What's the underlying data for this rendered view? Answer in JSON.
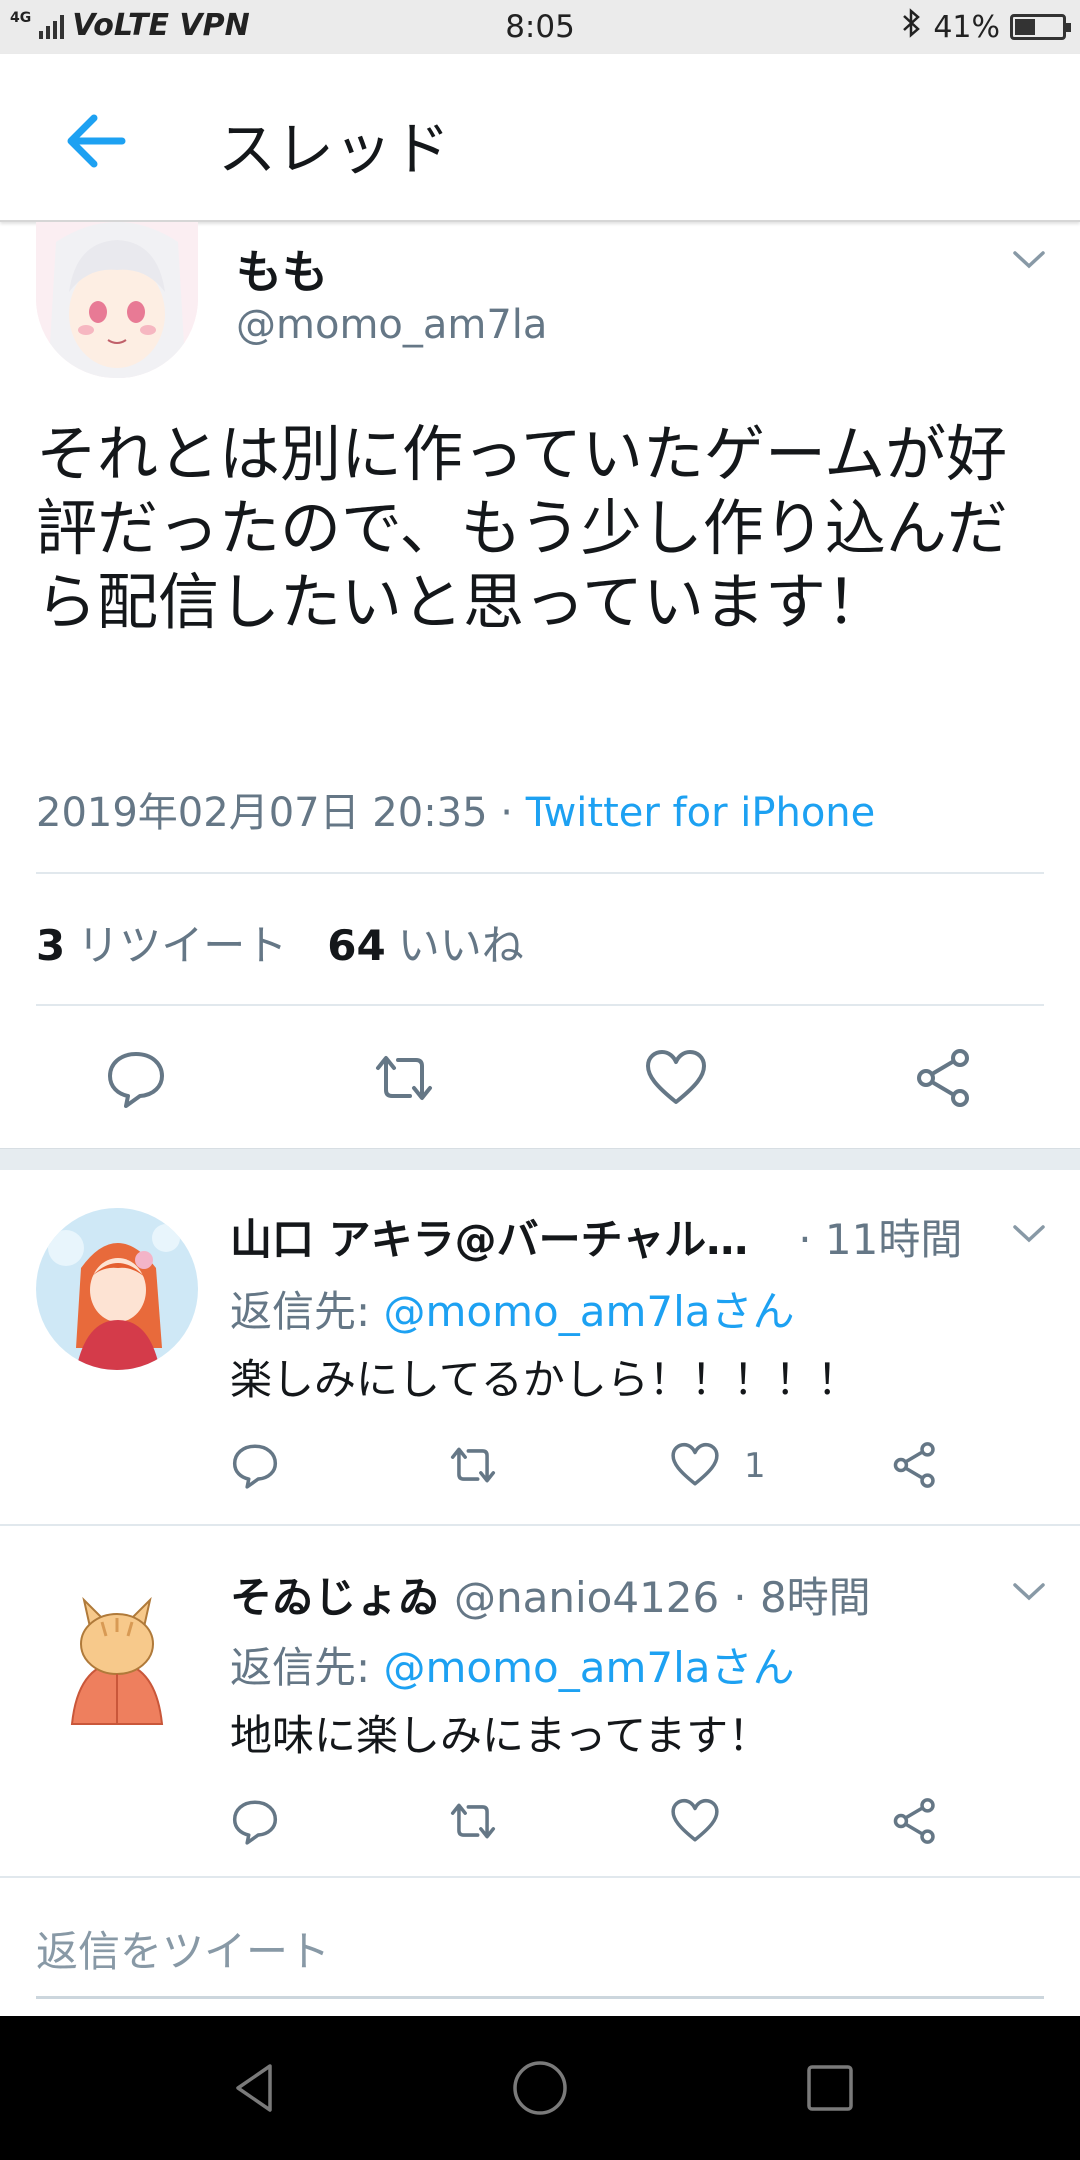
{
  "status_bar": {
    "left_text": "VoLTE VPN",
    "network": "4G",
    "time": "8:05",
    "battery": "41%"
  },
  "header": {
    "title": "スレッド"
  },
  "main_tweet": {
    "name": "もも",
    "handle": "@momo_am7la",
    "text": "それとは別に作っていたゲームが好評だったので、もう少し作り込んだら配信したいと思っています！",
    "timestamp": "2019年02月07日 20:35",
    "separator": " · ",
    "via": "Twitter for iPhone",
    "retweets_count": "3",
    "retweets_label": "リツイート",
    "likes_count": "64",
    "likes_label": "いいね"
  },
  "replies": [
    {
      "name": "山口 アキラ@バーチャル…",
      "time": "· 11時間",
      "reply_to_label": "返信先: ",
      "reply_to_user": "@momo_am7laさん",
      "text": "楽しみにしてるかしら！！！！！",
      "likes": "1"
    },
    {
      "name": "そゐじょゐ",
      "handle": "@nanio4126",
      "time": "· 8時間",
      "reply_to_label": "返信先: ",
      "reply_to_user": "@momo_am7laさん",
      "text": "地味に楽しみにまってます！",
      "likes": ""
    }
  ],
  "compose": {
    "placeholder": "返信をツイート"
  },
  "colors": {
    "accent": "#1da1f2",
    "secondary_text": "#657786",
    "icon_gray": "#657786"
  }
}
